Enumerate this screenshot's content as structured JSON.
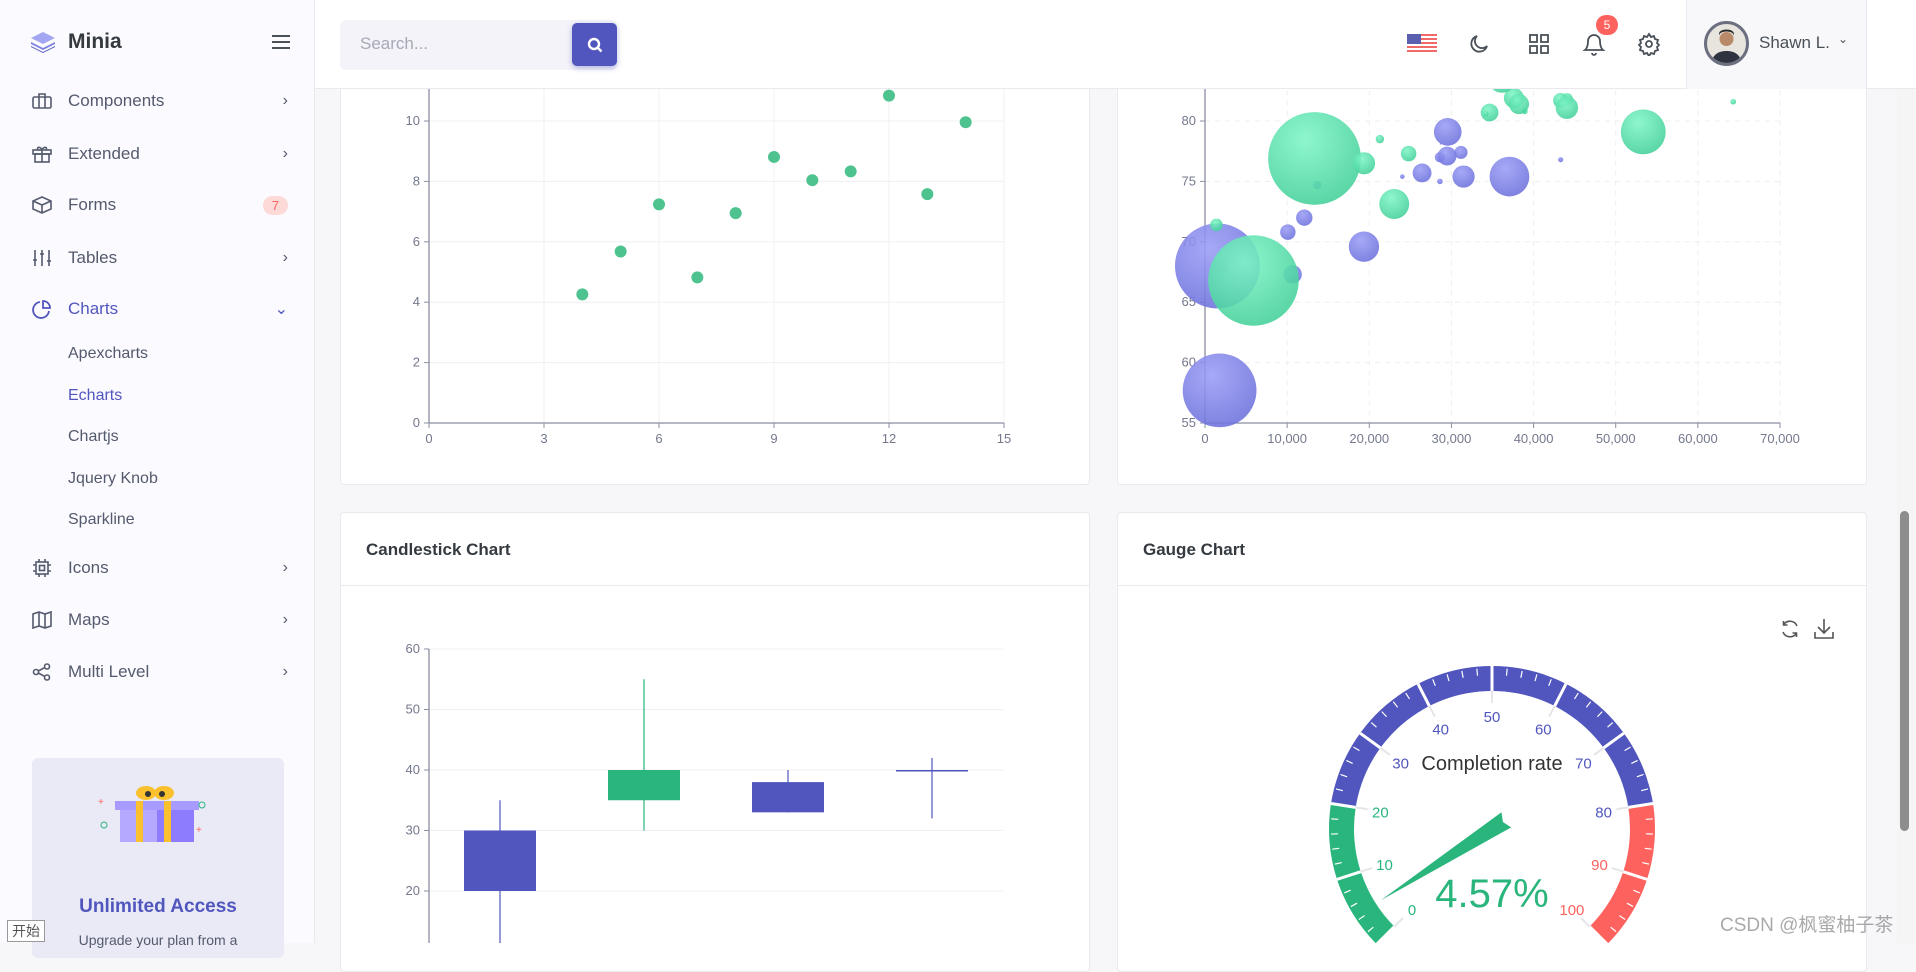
{
  "app": {
    "name": "Minia"
  },
  "sidebar": {
    "items": [
      {
        "label": "Components",
        "icon": "briefcase-icon"
      },
      {
        "label": "Extended",
        "icon": "gift-icon"
      },
      {
        "label": "Forms",
        "icon": "box-icon",
        "badge": "7"
      },
      {
        "label": "Tables",
        "icon": "sliders-icon"
      },
      {
        "label": "Charts",
        "icon": "pie-chart-icon",
        "active": true
      },
      {
        "label": "Icons",
        "icon": "cpu-icon"
      },
      {
        "label": "Maps",
        "icon": "map-icon"
      },
      {
        "label": "Multi Level",
        "icon": "share-icon"
      }
    ],
    "charts_submenu": [
      "Apexcharts",
      "Echarts",
      "Chartjs",
      "Jquery Knob",
      "Sparkline"
    ],
    "active_submenu": "Echarts",
    "promo": {
      "title": "Unlimited Access",
      "text": "Upgrade your plan from a"
    }
  },
  "header": {
    "search_placeholder": "Search...",
    "notification_count": "5",
    "user_name": "Shawn L."
  },
  "cards": {
    "candlestick_title": "Candlestick Chart",
    "gauge_title": "Gauge Chart"
  },
  "colors": {
    "primary": "#5156be",
    "success": "#2ab57d",
    "danger": "#fd625e",
    "bubble_a": "#7b7fe0",
    "bubble_b": "#4fdca0"
  },
  "overlay": {
    "start_label": "开始",
    "watermark": "CSDN @枫蜜柚子茶"
  },
  "chart_data": [
    {
      "type": "scatter",
      "x": [
        4,
        5,
        6,
        7,
        8,
        9,
        10,
        11,
        12,
        13,
        14
      ],
      "y": [
        4.26,
        5.68,
        7.24,
        4.82,
        6.95,
        8.81,
        8.04,
        8.33,
        10.84,
        7.58,
        9.96
      ],
      "xlim": [
        0,
        15
      ],
      "ylim": [
        0,
        12
      ],
      "xticks": [
        "0",
        "3",
        "6",
        "9",
        "12",
        "15"
      ],
      "yticks": [
        "0",
        "2",
        "4",
        "6",
        "8",
        "10"
      ],
      "grid": true
    },
    {
      "type": "scatter",
      "subtype": "bubble",
      "xlim": [
        0,
        70000
      ],
      "ylim": [
        55,
        85
      ],
      "xticks": [
        "0",
        "10,000",
        "20,000",
        "30,000",
        "40,000",
        "50,000",
        "60,000",
        "70,000"
      ],
      "yticks": [
        "55",
        "60",
        "65",
        "70",
        "75",
        "80"
      ],
      "grid": true,
      "series": [
        {
          "points": [
            [
              28604,
              77,
              17096869
            ],
            [
              31163,
              77.4,
              27662440
            ],
            [
              1516,
              68,
              1154605773
            ],
            [
              13670,
              74.7,
              10582082
            ],
            [
              28599,
              75,
              4986705
            ],
            [
              29476,
              77.1,
              56943299
            ],
            [
              31476,
              75.4,
              78958237
            ],
            [
              28666,
              78.1,
              254830
            ],
            [
              1777,
              57.7,
              870601776
            ],
            [
              29550,
              79.1,
              122249285
            ],
            [
              2076,
              67.9,
              20194354
            ],
            [
              12087,
              72,
              42972254
            ],
            [
              24021,
              75.4,
              3397534
            ],
            [
              43296,
              76.8,
              4240375
            ],
            [
              10088,
              70.8,
              38195258
            ],
            [
              19349,
              69.6,
              147568552
            ],
            [
              10670,
              67.3,
              53994605
            ],
            [
              26424,
              75.7,
              57110117
            ],
            [
              37062,
              75.4,
              252847810
            ]
          ]
        },
        {
          "points": [
            [
              44056,
              81.8,
              23968973
            ],
            [
              43294,
              81.7,
              35939927
            ],
            [
              13334,
              76.9,
              1376048943
            ],
            [
              21291,
              78.5,
              11389562
            ],
            [
              38923,
              80.8,
              5503457
            ],
            [
              37599,
              81.9,
              64395345
            ],
            [
              44053,
              81.1,
              80688545
            ],
            [
              42182,
              82.8,
              329425
            ],
            [
              5903,
              66.8,
              1311050527
            ],
            [
              36162,
              83.5,
              126573481
            ],
            [
              1390,
              71.4,
              25155317
            ],
            [
              34644,
              80.7,
              50293439
            ],
            [
              34186,
              80.6,
              4528526
            ],
            [
              64304,
              81.6,
              5210967
            ],
            [
              24787,
              77.3,
              38611794
            ],
            [
              23038,
              73.13,
              143456918
            ],
            [
              19360,
              76.5,
              78665830
            ],
            [
              38225,
              81.4,
              64715810
            ],
            [
              53354,
              79.1,
              321773631
            ]
          ]
        }
      ]
    },
    {
      "type": "candlestick",
      "title": "Candlestick Chart",
      "ylim": [
        0,
        60
      ],
      "yticks": [
        "20",
        "30",
        "40",
        "50",
        "60"
      ],
      "ohlc": [
        [
          20,
          30,
          10,
          35
        ],
        [
          40,
          35,
          30,
          55
        ],
        [
          33,
          38,
          33,
          40
        ],
        [
          40,
          40,
          32,
          42
        ]
      ],
      "grid": true
    },
    {
      "type": "gauge",
      "title": "Gauge Chart",
      "name": "Completion rate",
      "value": 4.57,
      "value_label": "4.57%",
      "range": [
        0,
        100
      ],
      "ticks": [
        "0",
        "10",
        "20",
        "30",
        "40",
        "50",
        "60",
        "70",
        "80",
        "90",
        "100"
      ],
      "bands": [
        {
          "to": 0.2,
          "color": "#2ab57d"
        },
        {
          "to": 0.8,
          "color": "#5156be"
        },
        {
          "to": 1,
          "color": "#fd625e"
        }
      ]
    }
  ]
}
